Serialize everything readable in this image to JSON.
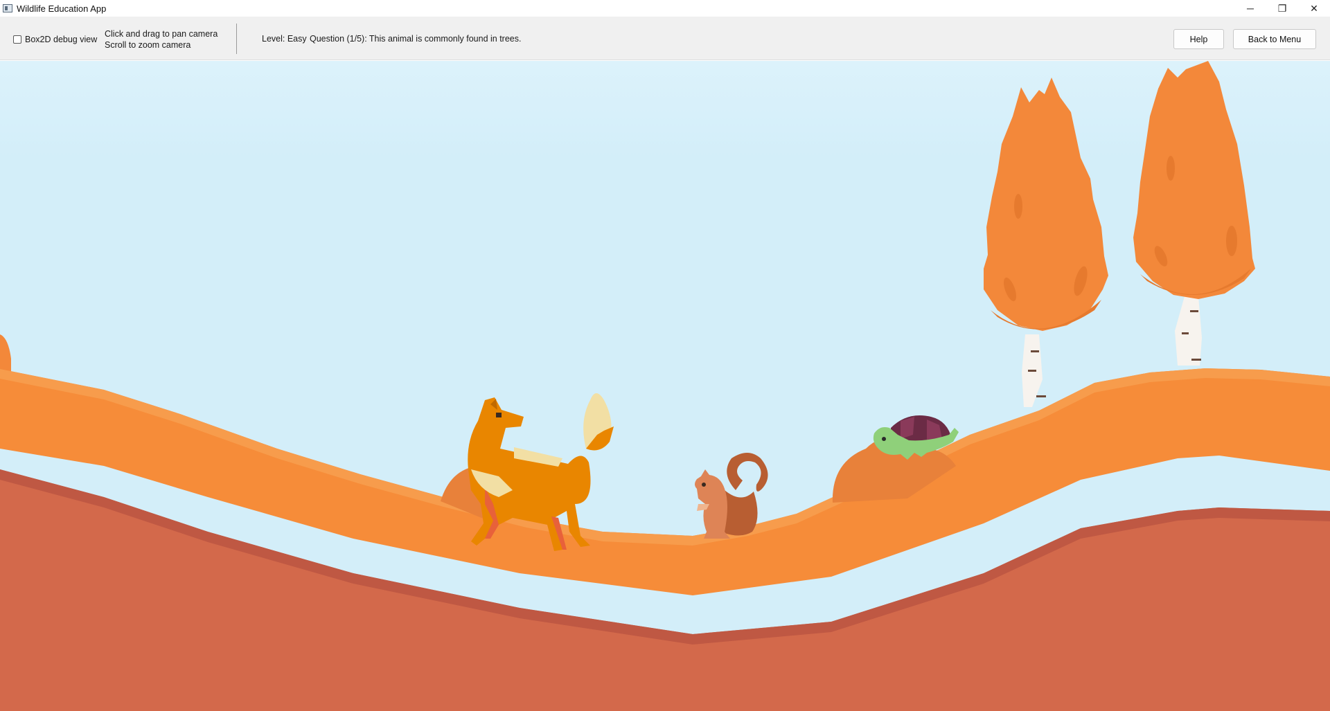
{
  "window": {
    "title": "Wildlife Education App",
    "controls": {
      "minimize": "─",
      "restore": "❐",
      "close": "✕"
    }
  },
  "toolbar": {
    "debug_checkbox": {
      "label": "Box2D debug view",
      "checked": false
    },
    "hint_line1": "Click and drag to pan camera",
    "hint_line2": "Scroll to zoom camera",
    "level": "Level: Easy",
    "question": "Question (1/5): This animal is commonly found in trees.",
    "help_label": "Help",
    "back_label": "Back to Menu"
  },
  "scene": {
    "animals": [
      "fox-icon",
      "squirrel-icon",
      "turtle-icon"
    ],
    "colors": {
      "sky_top": "#d9f1fb",
      "sky": "#d3eef9",
      "hill": "#f68c39",
      "hill_edge": "#f79c4c",
      "ground_dark": "#bf5843",
      "ground": "#d3694b",
      "tree_foliage": "#f3883a",
      "fox": "#e98600",
      "squirrel": "#de8456",
      "turtle_shell": "#6b2b45",
      "turtle_body": "#8fd07a"
    }
  }
}
